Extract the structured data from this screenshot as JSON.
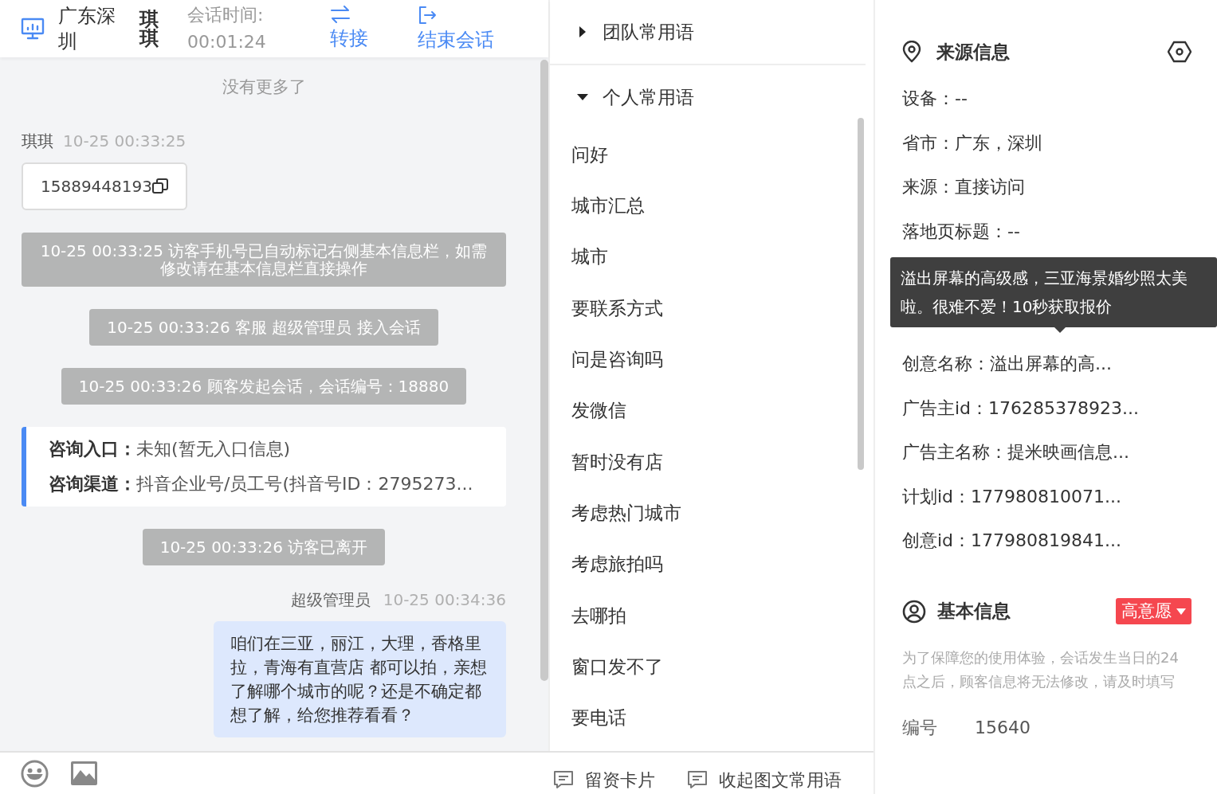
{
  "header": {
    "location": "广东深圳",
    "visitor": "琪琪",
    "timer_label": "会话时间:",
    "timer": "00:01:24",
    "actions": [
      {
        "label": "转接",
        "kind": "transfer"
      },
      {
        "label": "结束会话",
        "kind": "end"
      }
    ]
  },
  "chat": {
    "end_note": "没有更多了",
    "messages": [
      {
        "kind": "visitor",
        "name": "琪琪",
        "time": "10-25 00:33:25",
        "text": "15889448193"
      },
      {
        "kind": "system",
        "text": "10-25 00:33:25 访客手机号已自动标记右侧基本信息栏，如需修改请在基本信息栏直接操作"
      },
      {
        "kind": "system",
        "text": "10-25 00:33:26 客服 超级管理员 接入会话"
      },
      {
        "kind": "system",
        "text": "10-25 00:33:26 顾客发起会话，会话编号：18880"
      },
      {
        "kind": "entry_card",
        "lines": [
          {
            "label": "咨询入口：",
            "value": "未知(暂无入口信息)"
          },
          {
            "label": "咨询渠道：",
            "value": "抖音企业号/员工号(抖音号ID：2795273..."
          }
        ]
      },
      {
        "kind": "system",
        "text": "10-25 00:33:26 访客已离开"
      },
      {
        "kind": "agent",
        "name": "超级管理员",
        "time": "10-25 00:34:36",
        "text": "咱们在三亚，丽江，大理，香格里拉，青海有直营店 都可以拍，亲想了解哪个城市的呢？还是不确定都想了解，给您推荐看看？"
      }
    ]
  },
  "phrases": {
    "groups": [
      {
        "label": "团队常用语",
        "expanded": false
      },
      {
        "label": "个人常用语",
        "expanded": true,
        "items": [
          "问好",
          "城市汇总",
          "城市",
          "要联系方式",
          "问是咨询吗",
          "发微信",
          "暂时没有店",
          "考虑热门城市",
          "考虑旅拍吗",
          "去哪拍",
          "窗口发不了",
          "要电话"
        ]
      }
    ]
  },
  "toolbar": {
    "actions": [
      {
        "label": "留资卡片"
      },
      {
        "label": "收起图文常用语"
      }
    ]
  },
  "source": {
    "title": "来源信息",
    "fields": [
      "设备：--",
      "省市：广东，深圳",
      "来源：直接访问",
      "落地页标题：--",
      "创意名称：溢出屏幕的高...",
      "广告主id：176285378923...",
      "广告主名称：提米映画信息...",
      "计划id：177980810071...",
      "创意id：177980819841..."
    ],
    "tooltip": "溢出屏幕的高级感，三亚海景婚纱照太美啦。很难不爱！10秒获取报价"
  },
  "basic": {
    "title": "基本信息",
    "intent": "高意愿",
    "note": "为了保障您的使用体验，会话发生当日的24点之后，顾客信息将无法修改，请及时填写",
    "fields": [
      {
        "label": "编号",
        "value": "15640"
      }
    ]
  }
}
